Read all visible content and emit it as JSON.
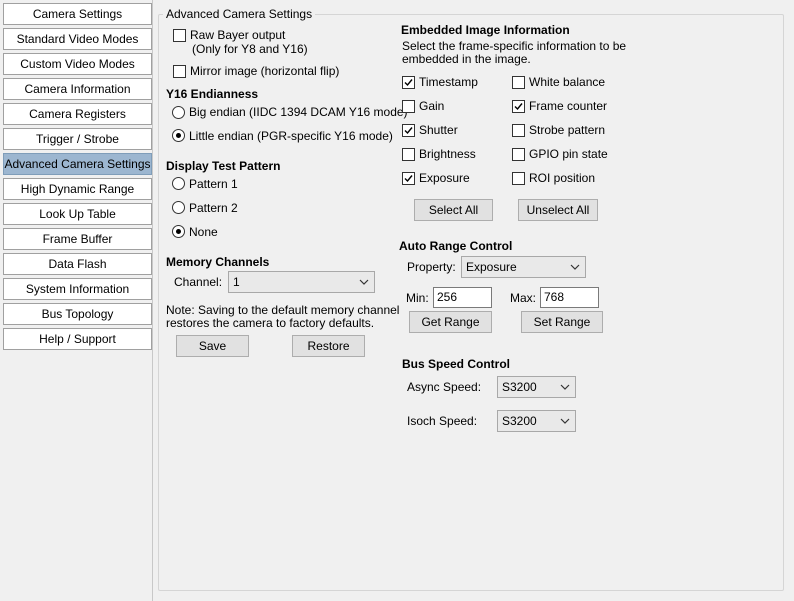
{
  "nav": {
    "items": [
      {
        "label": "Camera Settings"
      },
      {
        "label": "Standard Video Modes"
      },
      {
        "label": "Custom Video Modes"
      },
      {
        "label": "Camera Information"
      },
      {
        "label": "Camera Registers"
      },
      {
        "label": "Trigger / Strobe"
      },
      {
        "label": "Advanced Camera Settings",
        "active": true
      },
      {
        "label": "High Dynamic Range"
      },
      {
        "label": "Look Up Table"
      },
      {
        "label": "Frame Buffer"
      },
      {
        "label": "Data Flash"
      },
      {
        "label": "System Information"
      },
      {
        "label": "Bus Topology"
      },
      {
        "label": "Help / Support"
      }
    ]
  },
  "group_title": "Advanced Camera Settings",
  "raw_bayer": {
    "label1": "Raw Bayer output",
    "label2": "(Only for Y8 and Y16)",
    "checked": false
  },
  "mirror": {
    "label": "Mirror image (horizontal flip)",
    "checked": false
  },
  "endianness": {
    "heading": "Y16 Endianness",
    "big": "Big endian (IIDC 1394 DCAM Y16 mode)",
    "little": "Little endian (PGR-specific Y16 mode)",
    "selected": "little"
  },
  "test_pattern": {
    "heading": "Display Test Pattern",
    "p1": "Pattern 1",
    "p2": "Pattern 2",
    "none": "None",
    "selected": "none"
  },
  "memory": {
    "heading": "Memory Channels",
    "channel_label": "Channel:",
    "channel_value": "1",
    "note1": "Note: Saving to the default memory channel",
    "note2": "restores the camera to factory defaults.",
    "save": "Save",
    "restore": "Restore"
  },
  "embedded": {
    "heading": "Embedded Image Information",
    "desc1": "Select the frame-specific information to be",
    "desc2": "embedded in the image.",
    "timestamp": "Timestamp",
    "gain": "Gain",
    "shutter": "Shutter",
    "brightness": "Brightness",
    "exposure": "Exposure",
    "white_balance": "White balance",
    "frame_counter": "Frame counter",
    "strobe_pattern": "Strobe pattern",
    "gpio": "GPIO pin state",
    "roi": "ROI position",
    "select_all": "Select All",
    "unselect_all": "Unselect All"
  },
  "auto_range": {
    "heading": "Auto Range Control",
    "property_label": "Property:",
    "property_value": "Exposure",
    "min_label": "Min:",
    "min_value": "256",
    "max_label": "Max:",
    "max_value": "768",
    "get_range": "Get Range",
    "set_range": "Set Range"
  },
  "bus_speed": {
    "heading": "Bus Speed Control",
    "async_label": "Async Speed:",
    "async_value": "S3200",
    "isoch_label": "Isoch Speed:",
    "isoch_value": "S3200"
  }
}
